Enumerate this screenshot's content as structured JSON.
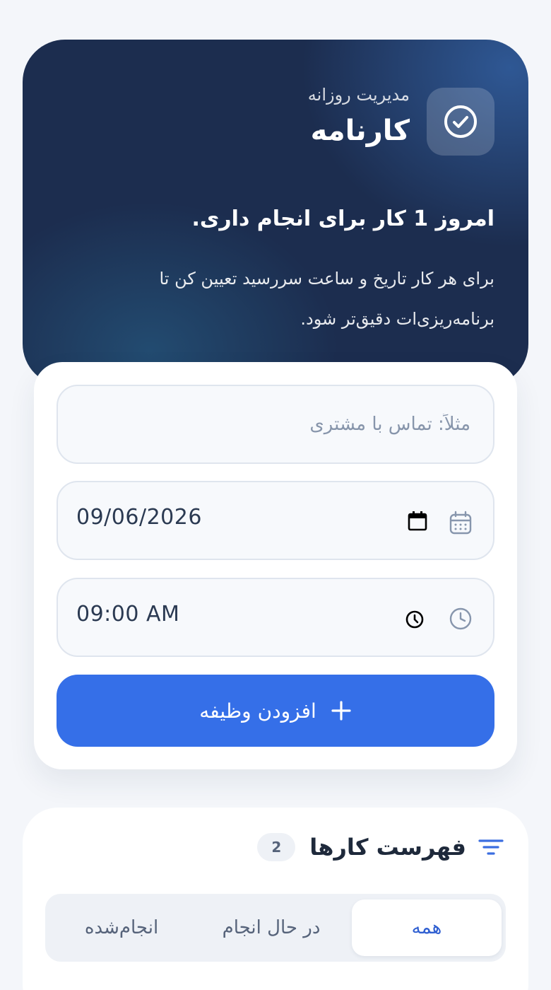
{
  "hero": {
    "subtitle": "مدیریت روزانه",
    "title": "کارنامه",
    "heading": "امروز 1 کار برای انجام داری.",
    "description": "برای هر کار تاریخ و ساعت سررسید تعیین کن تا برنامه‌ریزی‌ات دقیق‌تر شود.",
    "icon": "check-circle-icon"
  },
  "form": {
    "task_placeholder": "مثلاً: تماس با مشتری",
    "task_value": "",
    "date_value": "09/06/2026",
    "time_value": "09:00 AM",
    "add_label": "افزودن وظیفه"
  },
  "list": {
    "title": "فهرست کارها",
    "count": "2",
    "tabs": [
      {
        "label": "همه",
        "active": true
      },
      {
        "label": "در حال انجام",
        "active": false
      },
      {
        "label": "انجام‌شده",
        "active": false
      }
    ]
  },
  "colors": {
    "primary": "#356fe8",
    "hero_bg": "#1c2d4f",
    "page_bg": "#f4f6fa"
  }
}
